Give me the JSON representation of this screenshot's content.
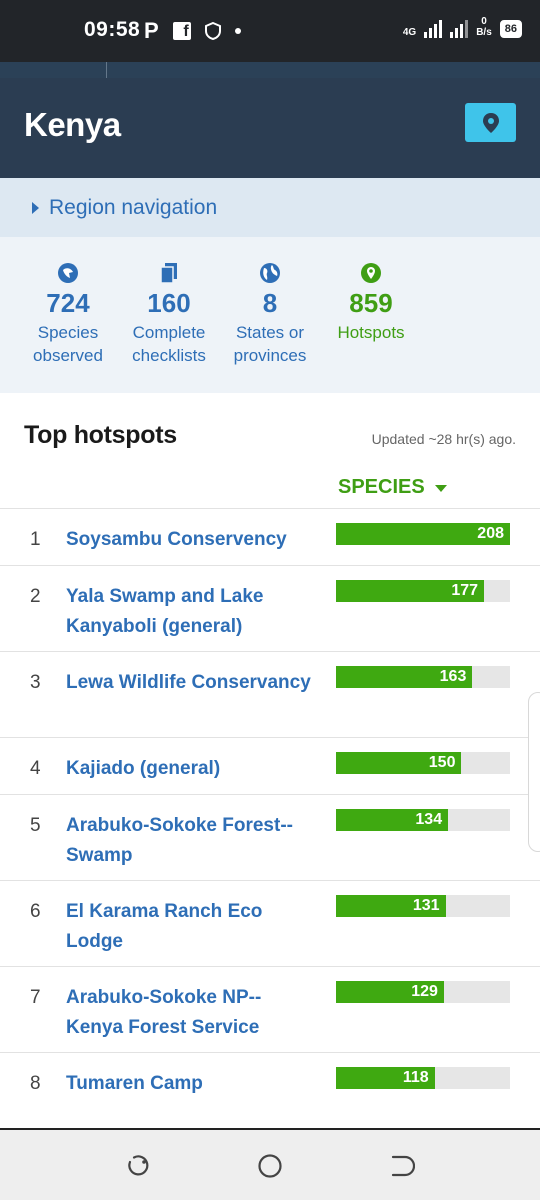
{
  "status_bar": {
    "time": "09:58",
    "app_icon_letter": "P",
    "social_letter": "f",
    "network": "4G",
    "speed_value": "0",
    "speed_unit": "B/s",
    "battery": "86",
    "icons": [
      "p-icon",
      "facebook-icon",
      "shield-icon",
      "dot-icon",
      "signal-icon",
      "speed-icon",
      "battery-icon"
    ]
  },
  "header": {
    "title": "Kenya",
    "map_button_icon": "location-pin-icon",
    "accent_color": "#3fc4ea",
    "background_color": "#2b3d52"
  },
  "region_nav": {
    "label": "Region navigation"
  },
  "stats": [
    {
      "icon": "species-icon",
      "value": "724",
      "label_line1": "Species",
      "label_line2": "observed",
      "color": "#2e6eb6"
    },
    {
      "icon": "checklist-icon",
      "value": "160",
      "label_line1": "Complete",
      "label_line2": "checklists",
      "color": "#2e6eb6"
    },
    {
      "icon": "globe-icon",
      "value": "8",
      "label_line1": "States or",
      "label_line2": "provinces",
      "color": "#2e6eb6"
    },
    {
      "icon": "hotspot-icon",
      "value": "859",
      "label_line1": "Hotspots",
      "label_line2": "",
      "color": "#3f9e14"
    }
  ],
  "hotspots": {
    "title": "Top hotspots",
    "updated": "Updated ~28 hr(s) ago.",
    "sort_label": "SPECIES",
    "max_value": 208,
    "items": [
      {
        "rank": "1",
        "name": "Soysambu Conservency",
        "species": 208
      },
      {
        "rank": "2",
        "name": "Yala Swamp and Lake Kanyaboli (general)",
        "species": 177
      },
      {
        "rank": "3",
        "name": "Lewa Wildlife Conservancy",
        "species": 163
      },
      {
        "rank": "4",
        "name": "Kajiado (general)",
        "species": 150
      },
      {
        "rank": "5",
        "name": "Arabuko-Sokoke Forest--Swamp",
        "species": 134
      },
      {
        "rank": "6",
        "name": "El Karama Ranch Eco Lodge",
        "species": 131
      },
      {
        "rank": "7",
        "name": "Arabuko-Sokoke NP--Kenya Forest Service",
        "species": 129
      },
      {
        "rank": "8",
        "name": "Tumaren Camp",
        "species": 118
      }
    ]
  },
  "nav_bar": {
    "buttons": [
      "recents-icon",
      "home-icon",
      "back-icon"
    ]
  }
}
